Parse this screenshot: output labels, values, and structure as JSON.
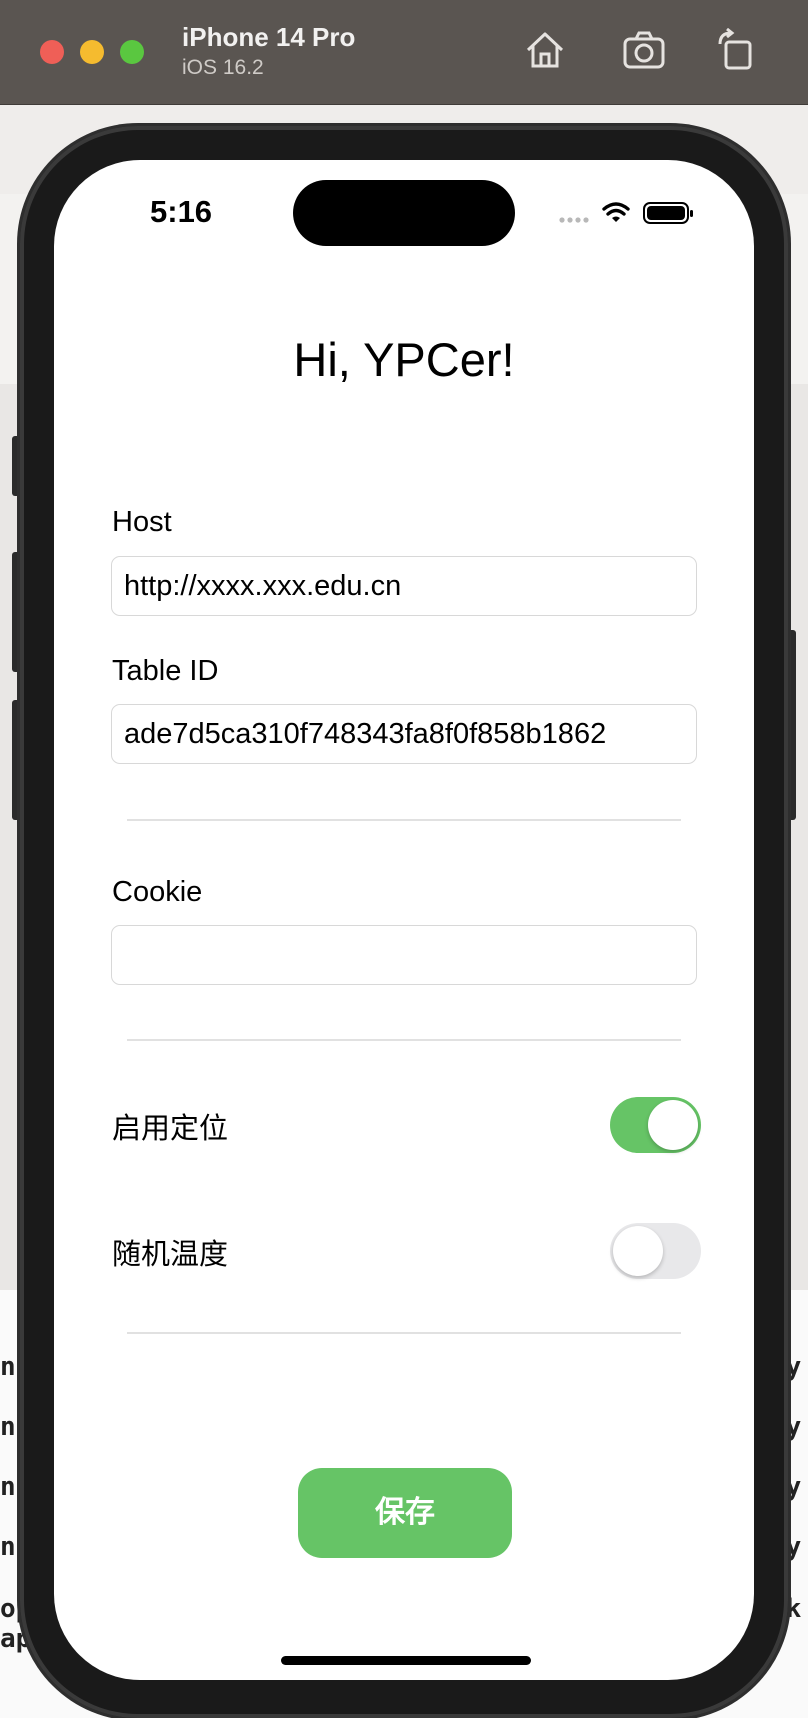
{
  "simulator": {
    "device_name": "iPhone 14 Pro",
    "os_version": "iOS 16.2",
    "toolbar_icons": [
      "home-icon",
      "screenshot-icon",
      "rotate-icon"
    ]
  },
  "status_bar": {
    "time": "5:16",
    "icons": [
      "cellular-icon",
      "wifi-icon",
      "battery-icon"
    ]
  },
  "greeting": "Hi, YPCer!",
  "form": {
    "host": {
      "label": "Host",
      "value": "http://xxxx.xxx.edu.cn"
    },
    "table_id": {
      "label": "Table ID",
      "value": "ade7d5ca310f748343fa8f0f858b1862"
    },
    "cookie": {
      "label": "Cookie",
      "value": ""
    }
  },
  "toggles": {
    "location": {
      "label": "启用定位",
      "on": true
    },
    "random_temp": {
      "label": "随机温度",
      "on": false
    }
  },
  "save_button": {
    "label": "保存"
  },
  "colors": {
    "accent_green": "#66c466",
    "titlebar": "#5a5551",
    "toggle_off": "#e8e8ea"
  }
}
